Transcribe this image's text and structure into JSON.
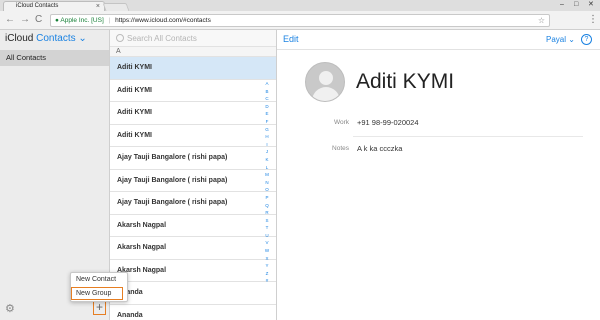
{
  "browser": {
    "tab_title": "iCloud Contacts",
    "tab_icon": "apple-icon",
    "close": "×",
    "back": "←",
    "forward": "→",
    "reload": "C",
    "secure_label": "Apple Inc. [US]",
    "url": "https://www.icloud.com/#contacts",
    "menu": "⋮",
    "win_min": "–",
    "win_max": "□",
    "win_close": "✕"
  },
  "groups": {
    "brand": "iCloud",
    "app": "Contacts",
    "chevron": "⌄",
    "items": [
      {
        "label": "All Contacts"
      }
    ]
  },
  "search": {
    "placeholder": "Search All Contacts"
  },
  "list": {
    "section_letter": "A",
    "contacts": [
      "Aditi KYMI",
      "Aditi KYMI",
      "Aditi KYMI",
      "Aditi KYMI",
      "Ajay Tauji Bangalore ( rishi papa)",
      "Ajay Tauji Bangalore ( rishi papa)",
      "Ajay Tauji Bangalore ( rishi papa)",
      "Akarsh Nagpal",
      "Akarsh Nagpal",
      "Akarsh Nagpal",
      "Ananda",
      "Ananda"
    ],
    "index": [
      "A",
      "B",
      "C",
      "D",
      "E",
      "F",
      "G",
      "H",
      "I",
      "J",
      "K",
      "L",
      "M",
      "N",
      "O",
      "P",
      "Q",
      "R",
      "S",
      "T",
      "U",
      "V",
      "W",
      "X",
      "Y",
      "Z",
      "#"
    ]
  },
  "popover": {
    "new_contact": "New Contact",
    "new_group": "New Group"
  },
  "detail": {
    "edit": "Edit",
    "user": "Payal",
    "user_chevron": "⌄",
    "help": "?",
    "name": "Aditi KYMI",
    "work_label": "Work",
    "work_value": "+91 98-99-020024",
    "notes_label": "Notes",
    "notes_value": "A k ka ccczka"
  },
  "colors": {
    "accent": "#1a82e2",
    "highlight": "#e67e22",
    "selected_row": "#d5e7f7"
  }
}
